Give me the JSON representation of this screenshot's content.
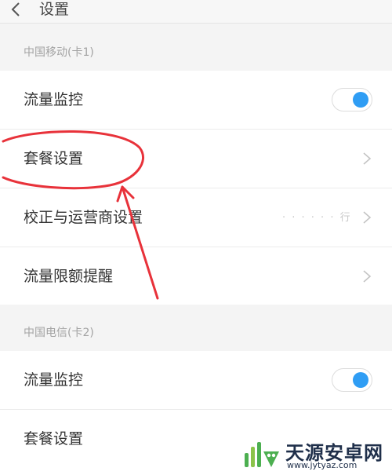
{
  "header": {
    "title": "设置",
    "back_icon": "chevron-left-icon"
  },
  "sim1": {
    "label": "中国移动(卡1)",
    "rows": [
      {
        "label": "流量监控",
        "control": "toggle",
        "on": true
      },
      {
        "label": "套餐设置",
        "control": "chevron"
      },
      {
        "label": "校正与运营商设置",
        "control": "chevron",
        "value": "· · · · · · 行"
      },
      {
        "label": "流量限额提醒",
        "control": "chevron"
      }
    ]
  },
  "sim2": {
    "label": "中国电信(卡2)",
    "rows": [
      {
        "label": "流量监控",
        "control": "toggle",
        "on": true
      },
      {
        "label": "套餐设置",
        "control": "chevron"
      }
    ]
  },
  "colors": {
    "accent": "#2f9df4",
    "annotation": "#e8323a"
  },
  "watermark": {
    "name": "天源安卓网",
    "url": "www.jytyaz.com"
  }
}
